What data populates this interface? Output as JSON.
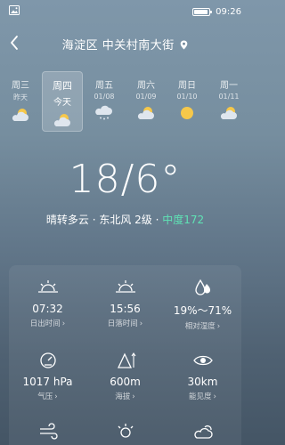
{
  "status": {
    "time": "09:26",
    "battery_level": 0.9
  },
  "header": {
    "location": "海淀区 中关村南大街"
  },
  "days": [
    {
      "name": "周三",
      "date": "昨天",
      "icon": "partly-cloudy-icon"
    },
    {
      "name": "周四",
      "date": "今天",
      "icon": "partly-cloudy-icon",
      "selected": true
    },
    {
      "name": "周五",
      "date": "01/08",
      "icon": "cloud-rain-snow-icon"
    },
    {
      "name": "周六",
      "date": "01/09",
      "icon": "partly-cloudy-icon"
    },
    {
      "name": "周日",
      "date": "01/10",
      "icon": "sunny-icon"
    },
    {
      "name": "周一",
      "date": "01/11",
      "icon": "partly-cloudy-icon"
    }
  ],
  "current": {
    "temperature": "18/6°",
    "condition": "晴转多云 · 东北风 2级 · ",
    "aqi": "中度172"
  },
  "details": [
    {
      "value": "07:32",
      "label": "日出时间",
      "icon": "sunrise-icon"
    },
    {
      "value": "15:56",
      "label": "日落时间",
      "icon": "sunset-icon"
    },
    {
      "value": "19%～71%",
      "label": "相对湿度",
      "icon": "humidity-icon"
    },
    {
      "value": "1017 hPa",
      "label": "气压",
      "icon": "pressure-gauge-icon"
    },
    {
      "value": "600m",
      "label": "海拔",
      "icon": "altitude-icon"
    },
    {
      "value": "30km",
      "label": "能见度",
      "icon": "visibility-eye-icon"
    }
  ],
  "colors": {
    "aqi": "#5fe3b5"
  }
}
